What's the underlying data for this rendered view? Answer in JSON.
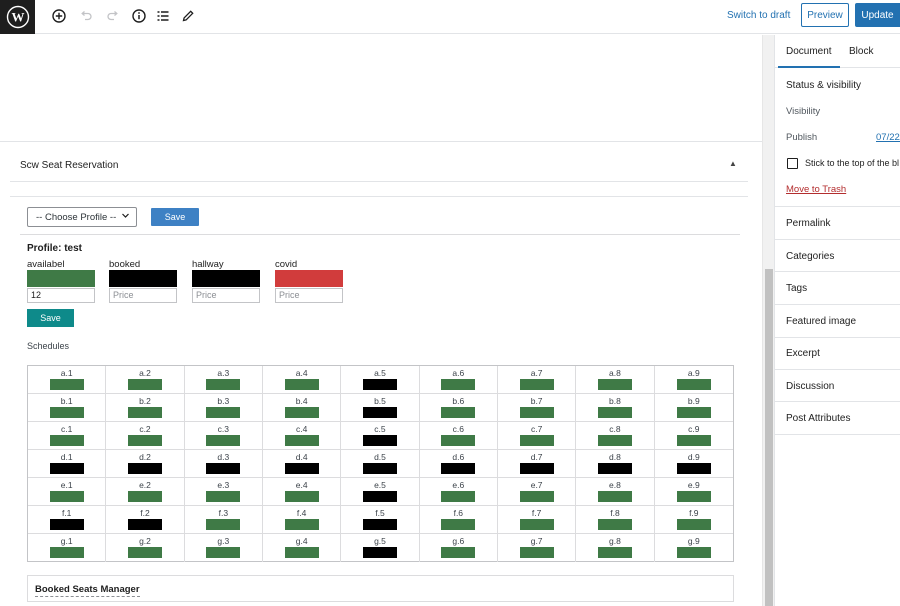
{
  "toolbar": {
    "switch_to_draft": "Switch to draft",
    "preview": "Preview",
    "update": "Update"
  },
  "panel": {
    "title": "Scw Seat Reservation",
    "profile_select": "-- Choose Profile --",
    "save_top": "Save",
    "profile_label": "Profile: test",
    "save_bottom": "Save",
    "schedules_label": "Schedules"
  },
  "statuses": [
    {
      "name": "availabel",
      "color": "#3f7a46",
      "value": "12",
      "placeholder": "Price"
    },
    {
      "name": "booked",
      "color": "#000000",
      "value": "",
      "placeholder": "Price"
    },
    {
      "name": "hallway",
      "color": "#000000",
      "value": "",
      "placeholder": "Price"
    },
    {
      "name": "covid",
      "color": "#d13c3c",
      "value": "",
      "placeholder": "Price"
    }
  ],
  "status_colors": {
    "available": "#3f7a46",
    "booked": "#000000",
    "covid": "#d13c3c"
  },
  "seats": [
    [
      {
        "label": "a.1",
        "status": "available"
      },
      {
        "label": "a.2",
        "status": "available"
      },
      {
        "label": "a.3",
        "status": "available"
      },
      {
        "label": "a.4",
        "status": "available"
      },
      {
        "label": "a.5",
        "status": "booked"
      },
      {
        "label": "a.6",
        "status": "available"
      },
      {
        "label": "a.7",
        "status": "available"
      },
      {
        "label": "a.8",
        "status": "available"
      },
      {
        "label": "a.9",
        "status": "available"
      }
    ],
    [
      {
        "label": "b.1",
        "status": "available"
      },
      {
        "label": "b.2",
        "status": "available"
      },
      {
        "label": "b.3",
        "status": "available"
      },
      {
        "label": "b.4",
        "status": "available"
      },
      {
        "label": "b.5",
        "status": "booked"
      },
      {
        "label": "b.6",
        "status": "available"
      },
      {
        "label": "b.7",
        "status": "available"
      },
      {
        "label": "b.8",
        "status": "available"
      },
      {
        "label": "b.9",
        "status": "available"
      }
    ],
    [
      {
        "label": "c.1",
        "status": "available"
      },
      {
        "label": "c.2",
        "status": "available"
      },
      {
        "label": "c.3",
        "status": "available"
      },
      {
        "label": "c.4",
        "status": "available"
      },
      {
        "label": "c.5",
        "status": "booked"
      },
      {
        "label": "c.6",
        "status": "available"
      },
      {
        "label": "c.7",
        "status": "available"
      },
      {
        "label": "c.8",
        "status": "available"
      },
      {
        "label": "c.9",
        "status": "available"
      }
    ],
    [
      {
        "label": "d.1",
        "status": "booked"
      },
      {
        "label": "d.2",
        "status": "booked"
      },
      {
        "label": "d.3",
        "status": "booked"
      },
      {
        "label": "d.4",
        "status": "booked"
      },
      {
        "label": "d.5",
        "status": "booked"
      },
      {
        "label": "d.6",
        "status": "booked"
      },
      {
        "label": "d.7",
        "status": "booked"
      },
      {
        "label": "d.8",
        "status": "booked"
      },
      {
        "label": "d.9",
        "status": "booked"
      }
    ],
    [
      {
        "label": "e.1",
        "status": "available"
      },
      {
        "label": "e.2",
        "status": "available"
      },
      {
        "label": "e.3",
        "status": "available"
      },
      {
        "label": "e.4",
        "status": "available"
      },
      {
        "label": "e.5",
        "status": "booked"
      },
      {
        "label": "e.6",
        "status": "available"
      },
      {
        "label": "e.7",
        "status": "available"
      },
      {
        "label": "e.8",
        "status": "available"
      },
      {
        "label": "e.9",
        "status": "available"
      }
    ],
    [
      {
        "label": "f.1",
        "status": "booked"
      },
      {
        "label": "f.2",
        "status": "booked"
      },
      {
        "label": "f.3",
        "status": "available"
      },
      {
        "label": "f.4",
        "status": "available"
      },
      {
        "label": "f.5",
        "status": "booked"
      },
      {
        "label": "f.6",
        "status": "available"
      },
      {
        "label": "f.7",
        "status": "available"
      },
      {
        "label": "f.8",
        "status": "available"
      },
      {
        "label": "f.9",
        "status": "available"
      }
    ],
    [
      {
        "label": "g.1",
        "status": "available"
      },
      {
        "label": "g.2",
        "status": "available"
      },
      {
        "label": "g.3",
        "status": "available"
      },
      {
        "label": "g.4",
        "status": "available"
      },
      {
        "label": "g.5",
        "status": "booked"
      },
      {
        "label": "g.6",
        "status": "available"
      },
      {
        "label": "g.7",
        "status": "available"
      },
      {
        "label": "g.8",
        "status": "available"
      },
      {
        "label": "g.9",
        "status": "available"
      }
    ]
  ],
  "booked_manager": {
    "title": "Booked Seats Manager"
  },
  "sidebar": {
    "tab_document": "Document",
    "tab_block": "Block",
    "status_visibility": "Status & visibility",
    "visibility": "Visibility",
    "publish": "Publish",
    "publish_value": "07/22/",
    "stick_label": "Stick to the top of the bl",
    "move_to_trash": "Move to Trash",
    "sections": [
      "Permalink",
      "Categories",
      "Tags",
      "Featured image",
      "Excerpt",
      "Discussion",
      "Post Attributes"
    ]
  },
  "icons": {
    "logo": "wordpress-logo-icon",
    "add": "add-block-icon",
    "undo": "undo-icon",
    "redo": "redo-icon",
    "info": "info-icon",
    "outline": "list-view-icon",
    "edit": "pencil-icon"
  }
}
